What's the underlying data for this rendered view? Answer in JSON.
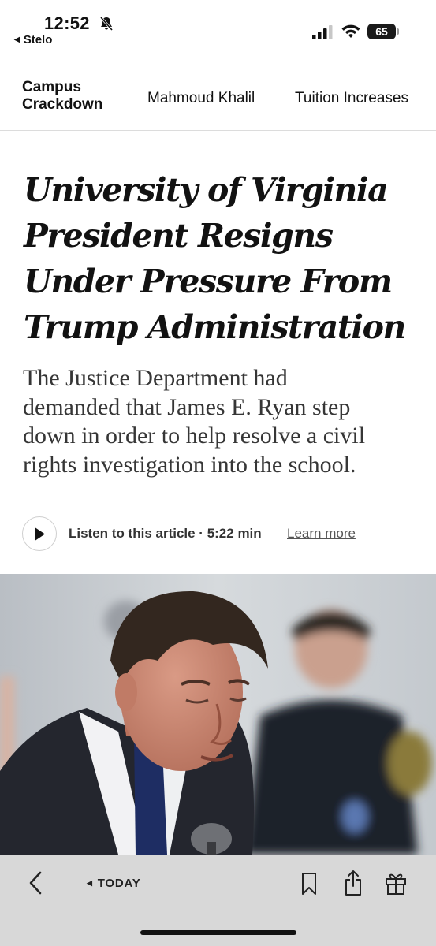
{
  "status_bar": {
    "time": "12:52",
    "back_app": "Stelo",
    "battery": "65"
  },
  "section_nav": {
    "brand_line1": "Campus",
    "brand_line2": "Crackdown",
    "items": [
      {
        "label": "Mahmoud Khalil"
      },
      {
        "label": "Tuition Increases"
      }
    ]
  },
  "article": {
    "headline_lines": [
      "University of Virginia",
      "President Resigns",
      "Under Pressure From",
      "Trump Administration"
    ],
    "summary_lines": [
      "The Justice Department had",
      "demanded that James E. Ryan step",
      "down in order to help resolve a civil",
      "rights investigation into the school."
    ],
    "listen_label": "Listen to this article · 5:22 min",
    "learn_more": "Learn more"
  },
  "toolbar": {
    "today_label": "TODAY"
  }
}
